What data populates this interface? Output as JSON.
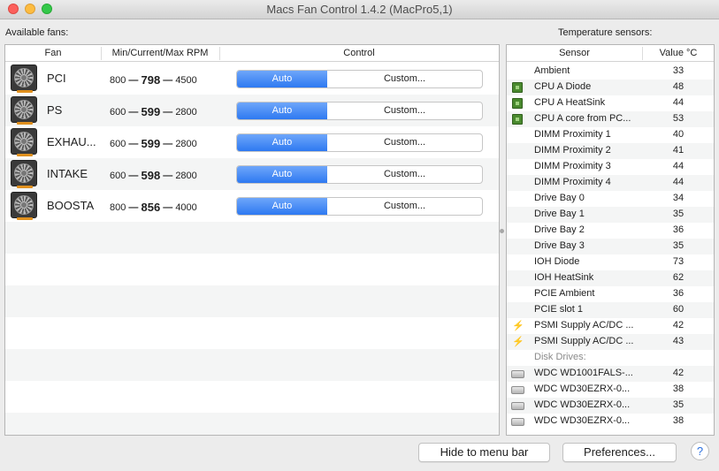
{
  "window": {
    "title": "Macs Fan Control 1.4.2 (MacPro5,1)"
  },
  "fans_section": {
    "label": "Available fans:",
    "columns": {
      "fan": "Fan",
      "rpm": "Min/Current/Max RPM",
      "control": "Control"
    },
    "control_auto_label": "Auto",
    "control_custom_label": "Custom...",
    "rpm_separator": "—",
    "fans": [
      {
        "name": "PCI",
        "min": "800",
        "current": "798",
        "max": "4500"
      },
      {
        "name": "PS",
        "min": "600",
        "current": "599",
        "max": "2800"
      },
      {
        "name": "EXHAU...",
        "min": "600",
        "current": "599",
        "max": "2800"
      },
      {
        "name": "INTAKE",
        "min": "600",
        "current": "598",
        "max": "2800"
      },
      {
        "name": "BOOSTA",
        "min": "800",
        "current": "856",
        "max": "4000"
      }
    ]
  },
  "sensors_section": {
    "label": "Temperature sensors:",
    "columns": {
      "sensor": "Sensor",
      "value": "Value °C"
    },
    "sensors": [
      {
        "icon": "none",
        "name": "Ambient",
        "value": "33"
      },
      {
        "icon": "cpu-chip-icon",
        "name": "CPU A Diode",
        "value": "48"
      },
      {
        "icon": "cpu-chip-icon",
        "name": "CPU A HeatSink",
        "value": "44"
      },
      {
        "icon": "cpu-chip-icon",
        "name": "CPU A core from PC...",
        "value": "53"
      },
      {
        "icon": "none",
        "name": "DIMM Proximity 1",
        "value": "40"
      },
      {
        "icon": "none",
        "name": "DIMM Proximity 2",
        "value": "41"
      },
      {
        "icon": "none",
        "name": "DIMM Proximity 3",
        "value": "44"
      },
      {
        "icon": "none",
        "name": "DIMM Proximity 4",
        "value": "44"
      },
      {
        "icon": "none",
        "name": "Drive Bay 0",
        "value": "34"
      },
      {
        "icon": "none",
        "name": "Drive Bay 1",
        "value": "35"
      },
      {
        "icon": "none",
        "name": "Drive Bay 2",
        "value": "36"
      },
      {
        "icon": "none",
        "name": "Drive Bay 3",
        "value": "35"
      },
      {
        "icon": "none",
        "name": "IOH Diode",
        "value": "73"
      },
      {
        "icon": "none",
        "name": "IOH HeatSink",
        "value": "62"
      },
      {
        "icon": "none",
        "name": "PCIE Ambient",
        "value": "36"
      },
      {
        "icon": "none",
        "name": "PCIE slot 1",
        "value": "60"
      },
      {
        "icon": "lightning-bolt-icon",
        "name": "PSMI Supply AC/DC ...",
        "value": "42"
      },
      {
        "icon": "lightning-bolt-icon",
        "name": "PSMI Supply AC/DC ...",
        "value": "43"
      },
      {
        "icon": "group",
        "name": "Disk Drives:",
        "value": ""
      },
      {
        "icon": "hard-disk-icon",
        "name": "WDC WD1001FALS-...",
        "value": "42"
      },
      {
        "icon": "hard-disk-icon",
        "name": "WDC WD30EZRX-0...",
        "value": "38"
      },
      {
        "icon": "hard-disk-icon",
        "name": "WDC WD30EZRX-0...",
        "value": "35"
      },
      {
        "icon": "hard-disk-icon",
        "name": "WDC WD30EZRX-0...",
        "value": "38"
      }
    ]
  },
  "footer": {
    "hide_label": "Hide to menu bar",
    "preferences_label": "Preferences...",
    "help_label": "?"
  },
  "colors": {
    "accent": "#2e79f1",
    "chip": "#4a8a2f",
    "bolt": "#e9b31a"
  }
}
